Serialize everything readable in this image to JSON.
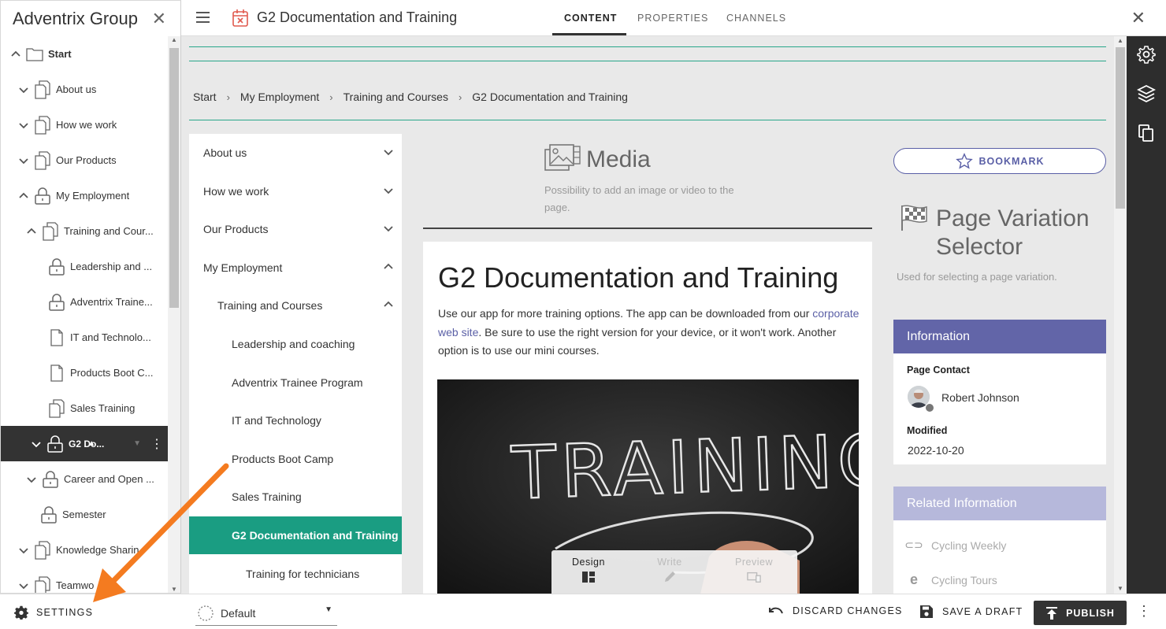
{
  "tree": {
    "title": "Adventrix Group",
    "items": [
      {
        "label": "Start",
        "chevron": "up",
        "icon": "folder-icon",
        "bold": true
      },
      {
        "label": "About us",
        "chevron": "down",
        "icon": "pages-icon"
      },
      {
        "label": "How we work",
        "chevron": "down",
        "icon": "pages-icon"
      },
      {
        "label": "Our Products",
        "chevron": "down",
        "icon": "pages-icon"
      },
      {
        "label": "My Employment",
        "chevron": "up",
        "icon": "lock-icon"
      },
      {
        "label": "Training and Cour...",
        "chevron": "up",
        "icon": "pages-icon"
      },
      {
        "label": "Leadership and ...",
        "chevron": "",
        "icon": "lock-icon"
      },
      {
        "label": "Adventrix Traine...",
        "chevron": "",
        "icon": "lock-icon"
      },
      {
        "label": "IT and Technolo...",
        "chevron": "",
        "icon": "page-icon"
      },
      {
        "label": "Products Boot C...",
        "chevron": "",
        "icon": "page-icon"
      },
      {
        "label": "Sales Training",
        "chevron": "",
        "icon": "pages-icon"
      },
      {
        "label": "G2 Do...",
        "chevron": "down",
        "icon": "lock-icon",
        "selected": true
      },
      {
        "label": "Career and Open ...",
        "chevron": "down",
        "icon": "lock-icon"
      },
      {
        "label": "Semester",
        "chevron": "",
        "icon": "lock-icon"
      },
      {
        "label": "Knowledge Sharin",
        "chevron": "down",
        "icon": "pages-icon"
      },
      {
        "label": "Teamwo",
        "chevron": "down",
        "icon": "pages-icon"
      }
    ]
  },
  "topbar": {
    "page_title": "G2 Documentation and Training",
    "tabs": [
      "CONTENT",
      "PROPERTIES",
      "CHANNELS"
    ],
    "active_tab": "CONTENT"
  },
  "breadcrumb": [
    "Start",
    "My Employment",
    "Training and Courses",
    "G2 Documentation and Training"
  ],
  "subnav": [
    {
      "label": "About us",
      "level": 0,
      "chevron": "down"
    },
    {
      "label": "How we work",
      "level": 0,
      "chevron": "down"
    },
    {
      "label": "Our Products",
      "level": 0,
      "chevron": "down"
    },
    {
      "label": "My Employment",
      "level": 0,
      "chevron": "up"
    },
    {
      "label": "Training and Courses",
      "level": 1,
      "chevron": "up"
    },
    {
      "label": "Leadership and coaching",
      "level": 2,
      "chevron": ""
    },
    {
      "label": "Adventrix Trainee Program",
      "level": 2,
      "chevron": ""
    },
    {
      "label": "IT and Technology",
      "level": 2,
      "chevron": ""
    },
    {
      "label": "Products Boot Camp",
      "level": 2,
      "chevron": ""
    },
    {
      "label": "Sales Training",
      "level": 2,
      "chevron": ""
    },
    {
      "label": "G2 Documentation and Training",
      "level": 2,
      "chevron": "",
      "active": true
    },
    {
      "label": "Training for technicians",
      "level": 3,
      "chevron": ""
    }
  ],
  "media": {
    "title": "Media",
    "description": "Possibility to add an image or video to the page."
  },
  "content": {
    "title": "G2 Documentation and Training",
    "body_before": "Use our app for more training options. The app can be downloaded from our ",
    "link": "corporate web site",
    "body_after": ". Be sure to use the right version for your device, or it won't work. Another option is to use our mini courses.",
    "image_text": "TRAINING"
  },
  "mode_switch": {
    "design": "Design",
    "write": "Write",
    "preview": "Preview"
  },
  "right_column": {
    "bookmark": "BOOKMARK",
    "pvs_title": "Page Variation Selector",
    "pvs_desc": "Used for selecting a page variation.",
    "info": {
      "header": "Information",
      "contact_label": "Page Contact",
      "contact_name": "Robert Johnson",
      "modified_label": "Modified",
      "modified_value": "2022-10-20"
    },
    "related": {
      "header": "Related Information",
      "items": [
        "Cycling Weekly",
        "Cycling Tours"
      ]
    }
  },
  "bottombar": {
    "settings": "SETTINGS",
    "variation": "Default",
    "discard": "DISCARD CHANGES",
    "save": "SAVE A DRAFT",
    "publish": "PUBLISH"
  },
  "colors": {
    "accent_green": "#1a9d82",
    "info_header": "#6265a8",
    "related_header": "#b6b8db",
    "link": "#5a5fa6",
    "annotation_arrow": "#f47b20"
  }
}
